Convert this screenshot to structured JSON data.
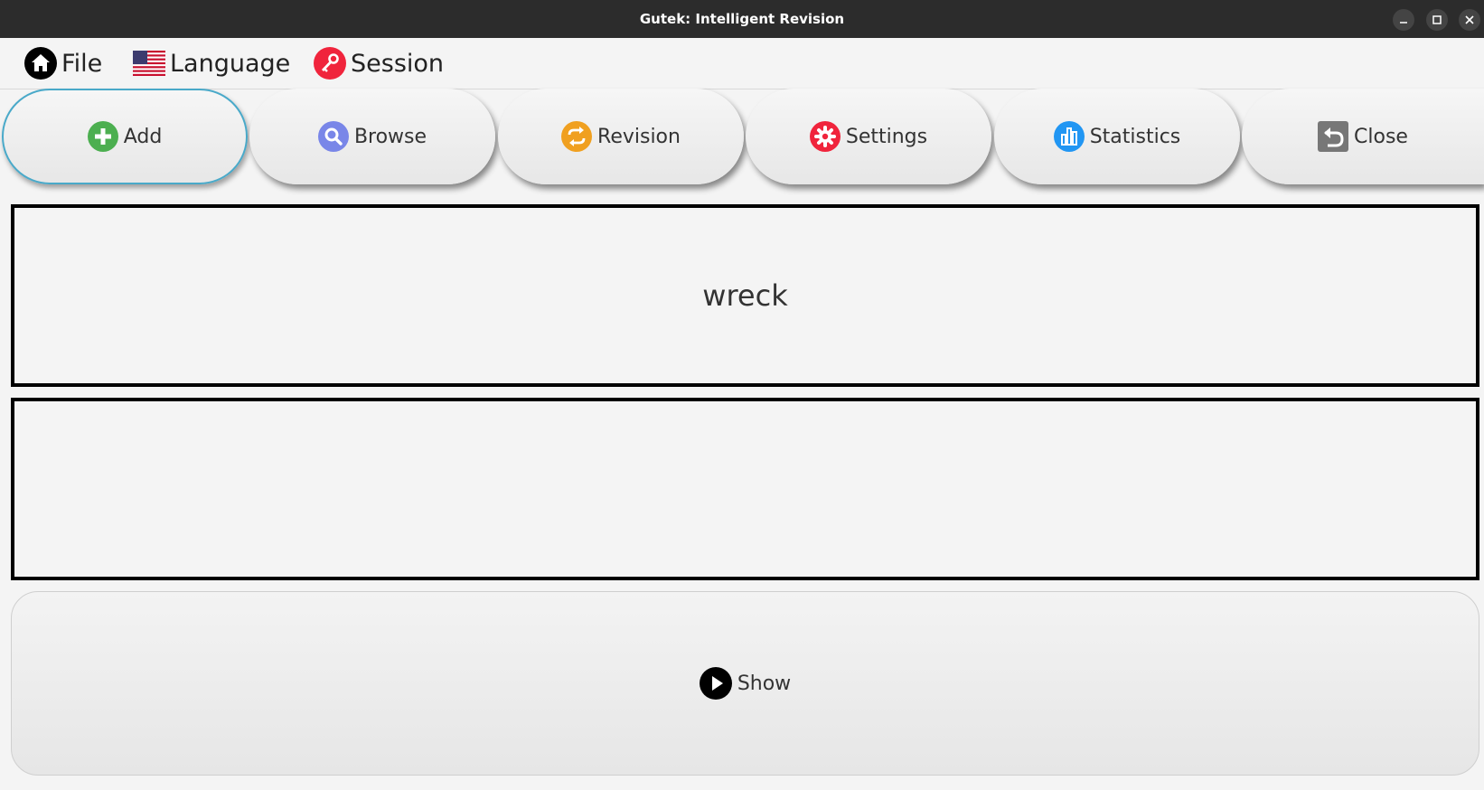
{
  "window": {
    "title": "Gutek: Intelligent Revision"
  },
  "menubar": {
    "items": [
      {
        "label": "File",
        "icon": "home-icon"
      },
      {
        "label": "Language",
        "icon": "us-flag-icon"
      },
      {
        "label": "Session",
        "icon": "key-icon"
      }
    ]
  },
  "toolbar": {
    "buttons": [
      {
        "label": "Add",
        "icon": "plus-circle-icon",
        "color": "#4caf50",
        "active": true
      },
      {
        "label": "Browse",
        "icon": "search-icon",
        "color": "#7986e8"
      },
      {
        "label": "Revision",
        "icon": "repeat-icon",
        "color": "#f0a020"
      },
      {
        "label": "Settings",
        "icon": "gear-icon",
        "color": "#f0243c"
      },
      {
        "label": "Statistics",
        "icon": "bar-chart-icon",
        "color": "#2196f3"
      },
      {
        "label": "Close",
        "icon": "back-arrow-icon",
        "color": "#777777"
      }
    ]
  },
  "card": {
    "question": "wreck",
    "answer": ""
  },
  "actions": {
    "show_label": "Show",
    "show_icon": "play-icon"
  },
  "colors": {
    "titlebar": "#2c2c2c",
    "background": "#f4f4f4",
    "active_border": "#49a9c9"
  }
}
